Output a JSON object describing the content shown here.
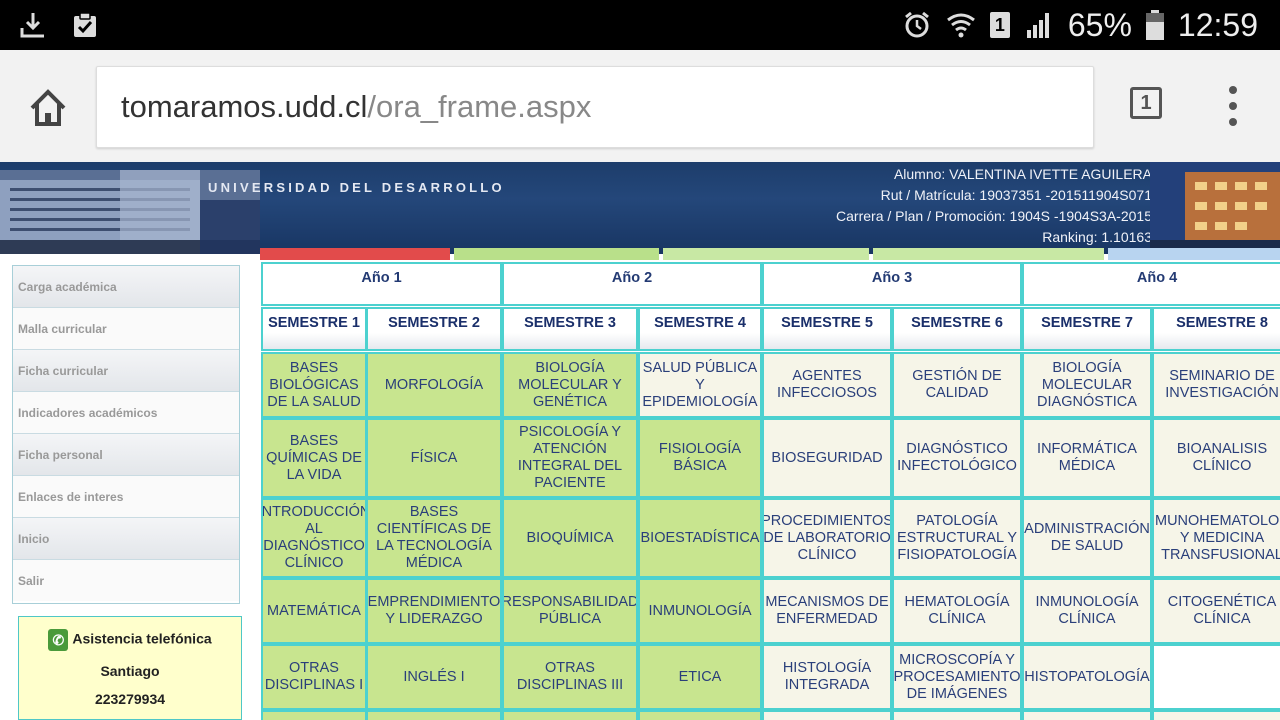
{
  "status_bar": {
    "battery_percent": "65%",
    "time": "12:59",
    "sim_label": "1",
    "icons_left": [
      "download-icon",
      "clipboard-check-icon"
    ],
    "icons_right": [
      "alarm-icon",
      "wifi-icon",
      "sim-icon",
      "signal-icon",
      "battery-icon"
    ]
  },
  "browser": {
    "url_domain": "tomaramos.udd.cl",
    "url_path": "/ora_frame.aspx",
    "tab_count": "1"
  },
  "header": {
    "university": "UNIVERSIDAD DEL DESARROLLO",
    "alumno": "Alumno: VALENTINA IVETTE  AGUILERA",
    "rut": "Rut / Matrícula: 19037351 -201511904S071",
    "carrera": "Carrera / Plan / Promoción: 1904S -1904S3A-2015",
    "ranking": "Ranking: 1.10163",
    "strip_colors": [
      "#e24b4b",
      "#b9e08a",
      "#c8e8a4",
      "#c8e8a4",
      "#b8d4f0"
    ]
  },
  "sidebar": {
    "items": [
      {
        "label": "Carga académica"
      },
      {
        "label": "Malla curricular"
      },
      {
        "label": "Ficha curricular"
      },
      {
        "label": "Indicadores académicos"
      },
      {
        "label": "Ficha personal"
      },
      {
        "label": "Enlaces de interes"
      },
      {
        "label": "Inicio"
      },
      {
        "label": "Salir"
      }
    ],
    "assist": {
      "title": "Asistencia telefónica",
      "city": "Santiago",
      "phone": "223279934"
    }
  },
  "grid": {
    "years": [
      "Año 1",
      "Año 2",
      "Año 3",
      "Año 4"
    ],
    "semesters": [
      "SEMESTRE 1",
      "SEMESTRE 2",
      "SEMESTRE 3",
      "SEMESTRE 4",
      "SEMESTRE 5",
      "SEMESTRE 6",
      "SEMESTRE 7",
      "SEMESTRE 8"
    ],
    "rows": [
      [
        {
          "text": "BASES BIOLÓGICAS DE LA SALUD",
          "status": "approved"
        },
        {
          "text": "MORFOLOGÍA",
          "status": "approved"
        },
        {
          "text": "BIOLOGÍA MOLECULAR Y GENÉTICA",
          "status": "approved"
        },
        {
          "text": "SALUD PÚBLICA Y EPIDEMIOLOGÍA",
          "status": "pending"
        },
        {
          "text": "AGENTES INFECCIOSOS",
          "status": "pending"
        },
        {
          "text": "GESTIÓN DE CALIDAD",
          "status": "pending"
        },
        {
          "text": "BIOLOGÍA MOLECULAR DIAGNÓSTICA",
          "status": "pending"
        },
        {
          "text": "SEMINARIO DE INVESTIGACIÓN",
          "status": "pending"
        }
      ],
      [
        {
          "text": "BASES QUÍMICAS DE LA VIDA",
          "status": "approved"
        },
        {
          "text": "FÍSICA",
          "status": "approved"
        },
        {
          "text": "PSICOLOGÍA Y ATENCIÓN INTEGRAL DEL PACIENTE",
          "status": "approved"
        },
        {
          "text": "FISIOLOGÍA BÁSICA",
          "status": "approved"
        },
        {
          "text": "BIOSEGURIDAD",
          "status": "pending"
        },
        {
          "text": "DIAGNÓSTICO INFECTOLÓGICO",
          "status": "pending"
        },
        {
          "text": "INFORMÁTICA MÉDICA",
          "status": "pending"
        },
        {
          "text": "BIOANALISIS CLÍNICO",
          "status": "pending"
        }
      ],
      [
        {
          "text": "INTRODUCCIÓN AL DIAGNÓSTICO CLÍNICO",
          "status": "approved"
        },
        {
          "text": "BASES CIENTÍFICAS DE LA TECNOLOGÍA MÉDICA",
          "status": "approved"
        },
        {
          "text": "BIOQUÍMICA",
          "status": "approved"
        },
        {
          "text": "BIOESTADÍSTICA",
          "status": "approved"
        },
        {
          "text": "PROCEDIMIENTOS DE LABORATORIO CLÍNICO",
          "status": "pending"
        },
        {
          "text": "PATOLOGÍA ESTRUCTURAL Y FISIOPATOLOGÍA",
          "status": "pending"
        },
        {
          "text": "ADMINISTRACIÓN DE SALUD",
          "status": "pending"
        },
        {
          "text": "INMUNOHEMATOLOGÍA Y MEDICINA TRANSFUSIONAL",
          "status": "pending"
        }
      ],
      [
        {
          "text": "MATEMÁTICA",
          "status": "approved"
        },
        {
          "text": "EMPRENDIMIENTO Y LIDERAZGO",
          "status": "approved"
        },
        {
          "text": "RESPONSABILIDAD PÚBLICA",
          "status": "approved"
        },
        {
          "text": "INMUNOLOGÍA",
          "status": "approved"
        },
        {
          "text": "MECANISMOS DE ENFERMEDAD",
          "status": "pending"
        },
        {
          "text": "HEMATOLOGÍA CLÍNICA",
          "status": "pending"
        },
        {
          "text": "INMUNOLOGÍA CLÍNICA",
          "status": "pending"
        },
        {
          "text": "CITOGENÉTICA CLÍNICA",
          "status": "pending"
        }
      ],
      [
        {
          "text": "OTRAS DISCIPLINAS I",
          "status": "approved"
        },
        {
          "text": "INGLÉS I",
          "status": "approved"
        },
        {
          "text": "OTRAS DISCIPLINAS III",
          "status": "approved"
        },
        {
          "text": "ETICA",
          "status": "approved"
        },
        {
          "text": "HISTOLOGÍA INTEGRADA",
          "status": "pending"
        },
        {
          "text": "MICROSCOPÍA Y PROCESAMIENTO DE IMÁGENES",
          "status": "pending"
        },
        {
          "text": "HISTOPATOLOGÍA",
          "status": "pending"
        },
        {
          "text": "",
          "status": "empty"
        }
      ]
    ],
    "status_colors": {
      "approved": "#c8e58f",
      "pending": "#f6f5e8",
      "empty": "#ffffff"
    }
  }
}
